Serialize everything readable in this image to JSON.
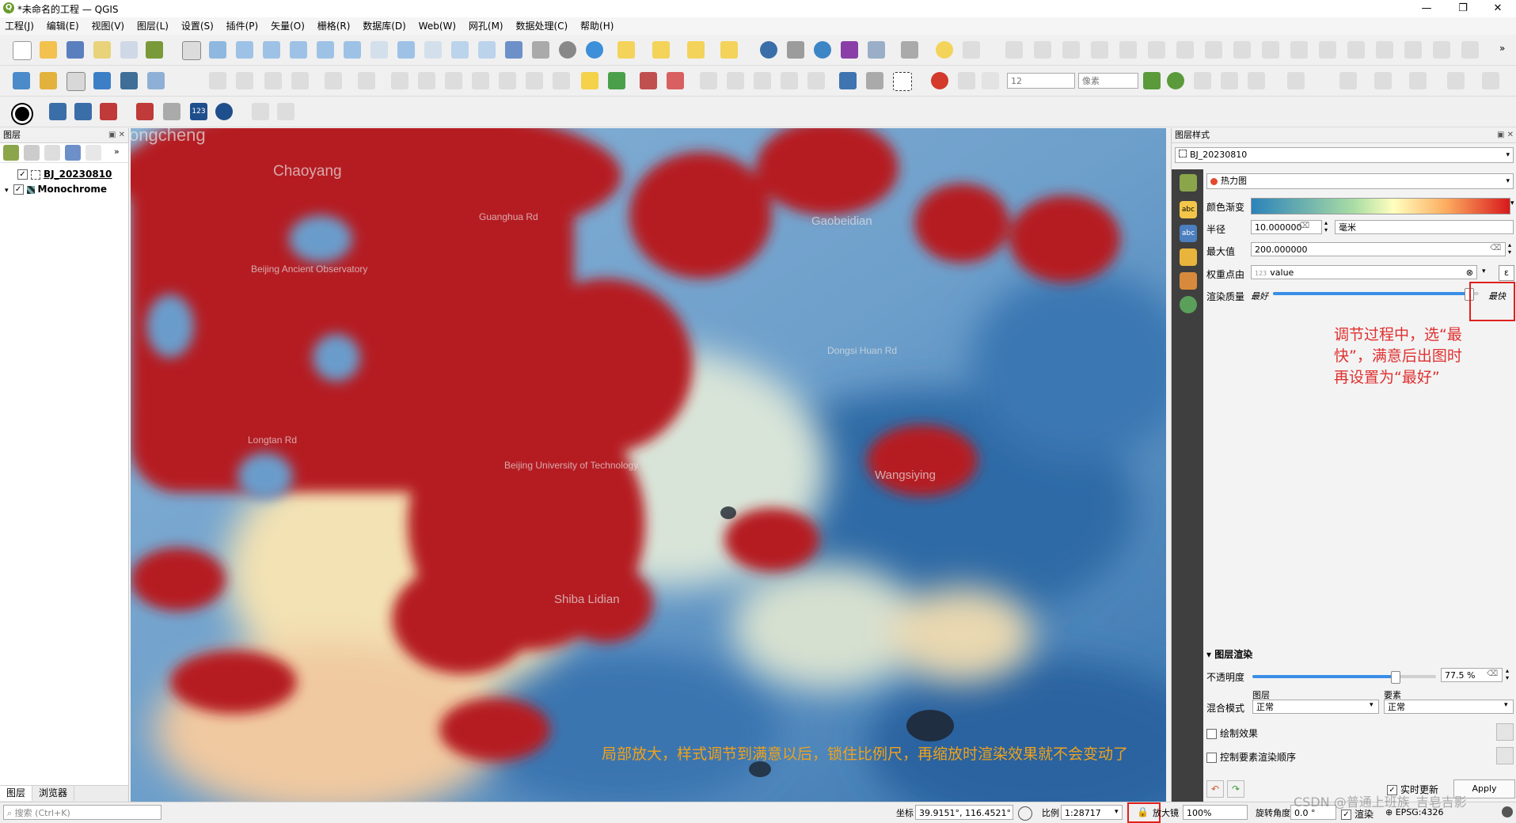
{
  "window": {
    "title": "*未命名的工程 — QGIS",
    "logo": "Q",
    "minimize": "—",
    "restore": "❐",
    "close": "✕"
  },
  "menu": [
    "工程(J)",
    "编辑(E)",
    "视图(V)",
    "图层(L)",
    "设置(S)",
    "插件(P)",
    "矢量(O)",
    "栅格(R)",
    "数据库(D)",
    "Web(W)",
    "网孔(M)",
    "数据处理(C)",
    "帮助(H)"
  ],
  "toolbar": {
    "size_value": "12",
    "units_value": "像素",
    "more": "»"
  },
  "layers_panel": {
    "title": "图层",
    "layers": [
      {
        "name": "BJ_20230810",
        "checked": true
      },
      {
        "name": "Monochrome",
        "checked": true
      }
    ],
    "tabs": [
      "图层",
      "浏览器"
    ]
  },
  "search": {
    "placeholder": "搜索 (Ctrl+K)"
  },
  "map": {
    "places": [
      "ongcheng",
      "Chaoyang",
      "Gaobeidian",
      "Wangsiying",
      "Shiba Lidian",
      "Beijing Ancient Observatory",
      "Guanghua Rd",
      "Longtan Rd",
      "Beijing University of Technology",
      "Dongsi Huan Rd"
    ],
    "annotation": "局部放大，样式调节到满意以后，锁住比例尺，再缩放时渲染效果就不会变动了"
  },
  "style_panel": {
    "title": "图层样式",
    "layer": "BJ_20230810",
    "renderer": "热力图",
    "color_ramp_label": "颜色渐变",
    "radius_label": "半径",
    "radius_value": "10.000000",
    "radius_unit": "毫米",
    "max_label": "最大值",
    "max_value": "200.000000",
    "weight_label": "权重点由",
    "weight_value": "value",
    "quality_label": "渲染质量",
    "quality_best": "最好",
    "quality_fast": "最快",
    "quality_level": 0.95,
    "note": "调节过程中，选“最快”，满意后出图时再设置为“最好”",
    "layer_render_title": "图层渲染",
    "opacity_label": "不透明度",
    "opacity_value": "77.5 %",
    "opacity_level": 0.775,
    "blend_label": "混合模式",
    "blend_layer_header": "图层",
    "blend_feature_header": "要素",
    "blend_layer_value": "正常",
    "blend_feature_value": "正常",
    "draw_effects": "绘制效果",
    "control_order": "控制要素渲染顺序",
    "live_update": "实时更新",
    "apply": "Apply"
  },
  "statusbar": {
    "coord_label": "坐标",
    "coord_value": "39.9151°, 116.4521°",
    "scale_label": "比例",
    "scale_value": "1:28717",
    "magnifier_label": "放大镜",
    "magnifier_value": "100%",
    "rotation_label": "旋转角度",
    "rotation_value": "0.0 °",
    "render_label": "渲染",
    "crs_value": "EPSG:4326",
    "watermark": "CSDN @普通上班族_吉皂吉影"
  },
  "colors": {
    "heat_red": "#b0181f",
    "heat_blue": "#3f7fb4",
    "annot_orange": "#f0a21a",
    "annot_red": "#e03030"
  }
}
